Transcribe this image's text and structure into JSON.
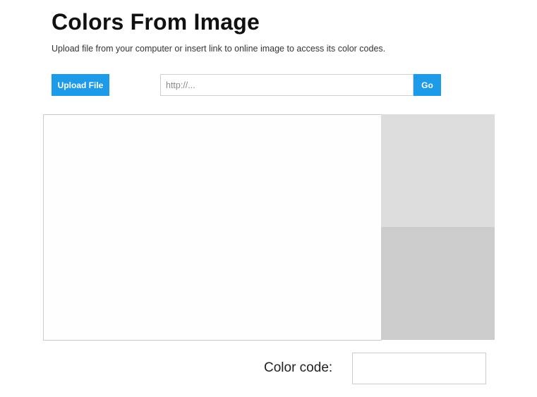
{
  "header": {
    "title": "Colors From Image",
    "subtitle": "Upload file from your computer or insert link to online image to access its color codes."
  },
  "controls": {
    "upload_label": "Upload File",
    "url_placeholder": "http://...",
    "url_value": "",
    "go_label": "Go"
  },
  "preview": {
    "swatches": [
      {
        "color": "#dddddd"
      },
      {
        "color": "#cccccc"
      }
    ]
  },
  "color_code": {
    "label": "Color code:",
    "value": ""
  }
}
